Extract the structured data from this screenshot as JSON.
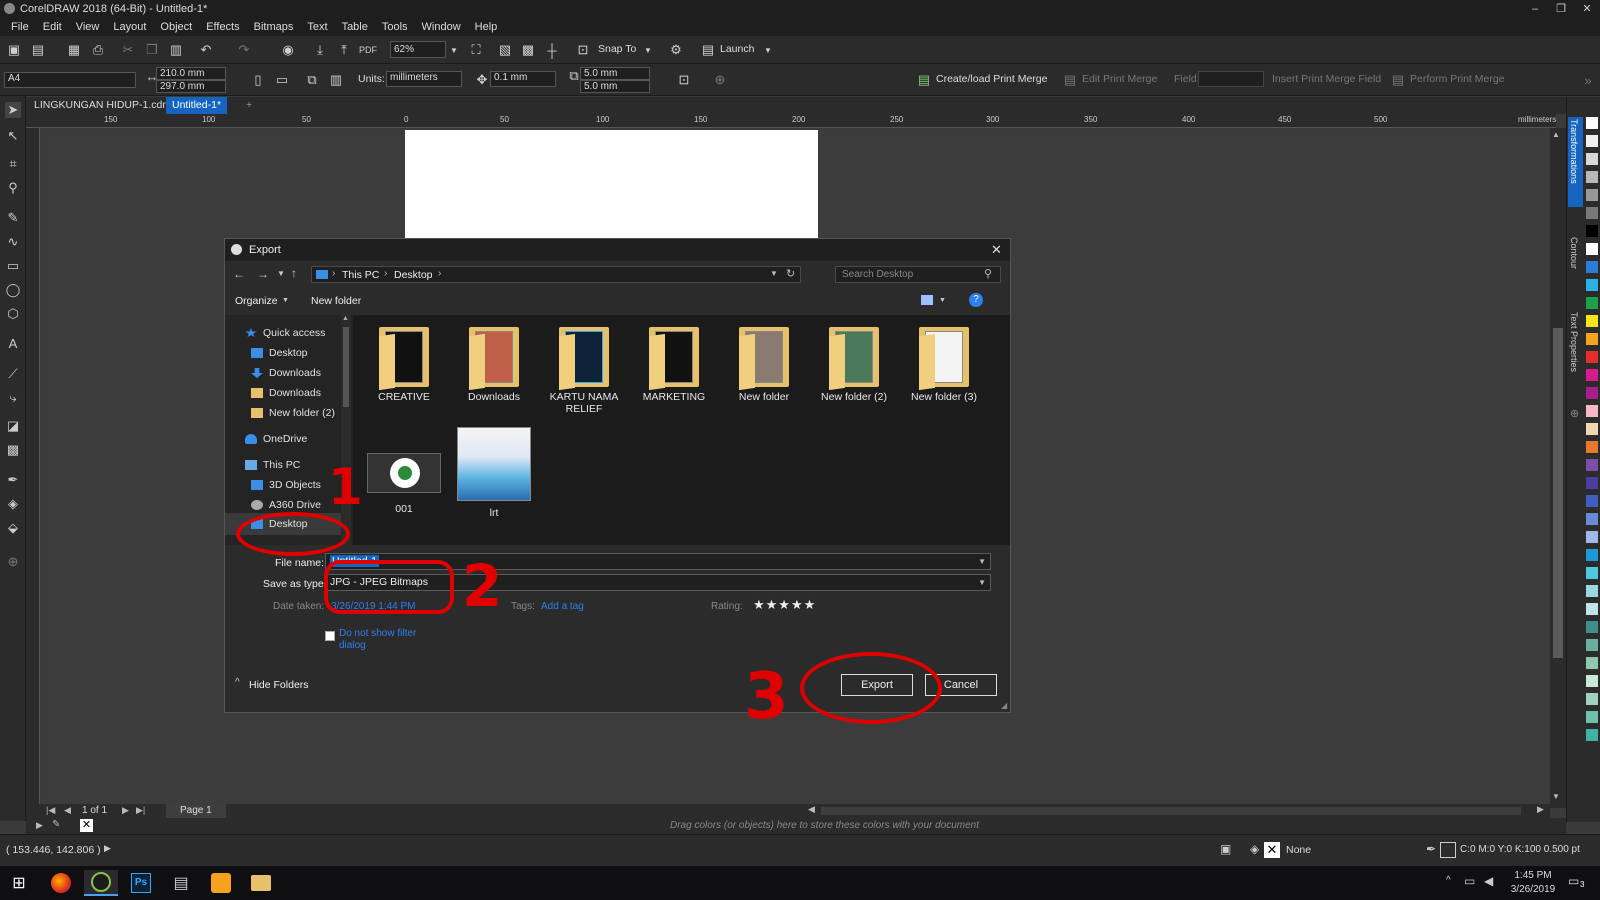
{
  "app": {
    "title": "CorelDRAW 2018 (64-Bit) - Untitled-1*",
    "window_controls": [
      "–",
      "❐",
      "✕"
    ]
  },
  "menu": [
    "File",
    "Edit",
    "View",
    "Layout",
    "Object",
    "Effects",
    "Bitmaps",
    "Text",
    "Table",
    "Tools",
    "Window",
    "Help"
  ],
  "toolbar": {
    "zoom": "62%",
    "snap_to": "Snap To",
    "launch": "Launch"
  },
  "propbar": {
    "page_size": "A4",
    "width": "210.0 mm",
    "height": "297.0 mm",
    "units_label": "Units:",
    "units": "millimeters",
    "nudge": "0.1 mm",
    "dup_x": "5.0 mm",
    "dup_y": "5.0 mm",
    "create_print_merge": "Create/load Print Merge",
    "edit_print_merge": "Edit Print Merge",
    "field_label": "Field:",
    "insert_field": "Insert Print Merge Field",
    "perform_merge": "Perform Print Merge"
  },
  "doc_tabs": [
    "LINGKUNGAN HIDUP-1.cdr*",
    "Untitled-1*"
  ],
  "ruler": {
    "numbers": [
      "150",
      "100",
      "50",
      "0",
      "50",
      "100",
      "150",
      "200",
      "250",
      "300",
      "350",
      "400",
      "450",
      "500"
    ],
    "unit": "millimeters"
  },
  "dockers": [
    "Transformations",
    "Contour",
    "Text Properties"
  ],
  "palette_colors": [
    "#ffffff",
    "#f0f0f0",
    "#d8d8d8",
    "#b8b8b8",
    "#989898",
    "#787878",
    "#000000",
    "#ffffff",
    "#2b7bd8",
    "#2ab2e5",
    "#1aa24a",
    "#f2e51c",
    "#f5a21c",
    "#e32c2c",
    "#d81c8f",
    "#a91c8c",
    "#f7b9c8",
    "#f0d7b0",
    "#e57a2c",
    "#7a4fa8",
    "#4a3ea0",
    "#3f5fc0",
    "#6a8ad8",
    "#a0b8e8",
    "#1b9ad6",
    "#4fc7e3",
    "#9ad8e0",
    "#c0e4ea",
    "#3f8f8f",
    "#6ab0a0",
    "#8fc8b0",
    "#c8e8d8",
    "#a0d0c0",
    "#70c0b0",
    "#40b0a0"
  ],
  "page_nav": {
    "page_count": "1 of 1",
    "page_tab": "Page 1"
  },
  "color_well_hint": "Drag colors (or objects) here to store these colors with your document",
  "status": {
    "coords": "( 153.446, 142.806 )",
    "fill": "None",
    "outline": "C:0 M:0 Y:0 K:100  0.500 pt"
  },
  "dialog": {
    "title": "Export",
    "breadcrumb": [
      "This PC",
      "Desktop"
    ],
    "search_placeholder": "Search Desktop",
    "organize": "Organize",
    "new_folder": "New folder",
    "nav": [
      {
        "label": "Quick access",
        "icon": "star-icon",
        "color": "#3a8ee6"
      },
      {
        "label": "Desktop",
        "icon": "desktop-icon",
        "color": "#3a8ee6"
      },
      {
        "label": "Downloads",
        "icon": "download-icon",
        "color": "#3a8ee6"
      },
      {
        "label": "Downloads",
        "icon": "folder-icon",
        "color": "#e6c06a"
      },
      {
        "label": "New folder (2)",
        "icon": "folder-icon",
        "color": "#e6c06a"
      },
      {
        "label": "OneDrive",
        "icon": "cloud-icon",
        "color": "#3a8ee6"
      },
      {
        "label": "This PC",
        "icon": "computer-icon",
        "color": "#6aa8e6"
      },
      {
        "label": "3D Objects",
        "icon": "cube-icon",
        "color": "#3a8ee6"
      },
      {
        "label": "A360 Drive",
        "icon": "drive-icon",
        "color": "#aaaaaa"
      },
      {
        "label": "Desktop",
        "icon": "desktop-icon",
        "color": "#3a8ee6"
      }
    ],
    "files": [
      {
        "label": "CREATIVE",
        "kind": "folder"
      },
      {
        "label": "Downloads",
        "kind": "folder"
      },
      {
        "label": "KARTU NAMA RELIEF",
        "kind": "folder"
      },
      {
        "label": "MARKETING",
        "kind": "folder"
      },
      {
        "label": "New folder",
        "kind": "folder"
      },
      {
        "label": "New folder (2)",
        "kind": "folder"
      },
      {
        "label": "New folder (3)",
        "kind": "folder"
      },
      {
        "label": "001",
        "kind": "image"
      },
      {
        "label": "lrt",
        "kind": "image"
      }
    ],
    "file_name_label": "File name:",
    "file_name": "Untitled-1",
    "save_type_label": "Save as type:",
    "save_type": "JPG - JPEG Bitmaps",
    "date_taken_label": "Date taken:",
    "date_taken": "3/26/2019 1:44 PM",
    "tags_label": "Tags:",
    "tags_value": "Add a tag",
    "rating_label": "Rating:",
    "rating_stars": "★★★★★",
    "no_filter": "Do not show filter dialog",
    "hide_folders": "Hide Folders",
    "export_btn": "Export",
    "cancel_btn": "Cancel"
  },
  "annotations": [
    "1",
    "2",
    "3"
  ],
  "taskbar": {
    "time": "1:45 PM",
    "date": "3/26/2019",
    "notif_count": "3"
  }
}
